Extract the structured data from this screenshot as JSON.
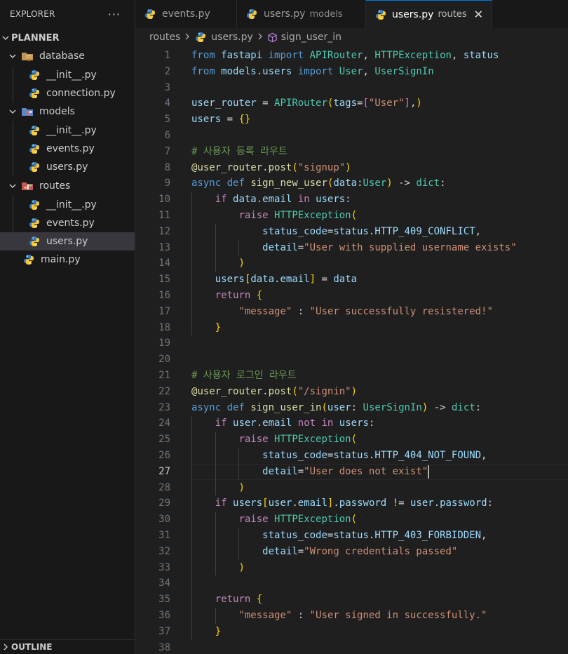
{
  "sidebar": {
    "title": "EXPLORER",
    "more": "···",
    "project": "PLANNER",
    "outline": "OUTLINE",
    "tree": [
      {
        "label": "database",
        "type": "folder"
      },
      {
        "label": "__init__.py",
        "type": "file"
      },
      {
        "label": "connection.py",
        "type": "file"
      },
      {
        "label": "models",
        "type": "folder"
      },
      {
        "label": "__init__.py",
        "type": "file"
      },
      {
        "label": "events.py",
        "type": "file"
      },
      {
        "label": "users.py",
        "type": "file"
      },
      {
        "label": "routes",
        "type": "folder"
      },
      {
        "label": "__init__.py",
        "type": "file"
      },
      {
        "label": "events.py",
        "type": "file"
      },
      {
        "label": "users.py",
        "type": "file",
        "selected": true
      },
      {
        "label": "main.py",
        "type": "file"
      }
    ]
  },
  "tabs": [
    {
      "label": "events.py",
      "desc": ""
    },
    {
      "label": "users.py",
      "desc": "models"
    },
    {
      "label": "users.py",
      "desc": "routes",
      "active": true,
      "close": "✕"
    }
  ],
  "breadcrumb": {
    "folder": "routes",
    "file": "users.py",
    "symbol": "sign_user_in"
  },
  "editor": {
    "current_line": 27,
    "line_numbers": [
      "1",
      "2",
      "3",
      "4",
      "5",
      "6",
      "7",
      "8",
      "9",
      "10",
      "11",
      "12",
      "13",
      "14",
      "15",
      "16",
      "17",
      "18",
      "19",
      "20",
      "21",
      "22",
      "23",
      "24",
      "25",
      "26",
      "27",
      "28",
      "29",
      "30",
      "31",
      "32",
      "33",
      "34",
      "35",
      "36",
      "37",
      "38"
    ],
    "lines": [
      "from fastapi import APIRouter, HTTPException, status",
      "from models.users import User, UserSignIn",
      "",
      "user_router = APIRouter(tags=[\"User\"],)",
      "users = {}",
      "",
      "# 사용자 등록 라우트",
      "@user_router.post(\"signup\")",
      "async def sign_new_user(data:User) -> dict:",
      "    if data.email in users:",
      "        raise HTTPException(",
      "            status_code=status.HTTP_409_CONFLICT,",
      "            detail=\"User with supplied username exists\"",
      "        )",
      "    users[data.email] = data",
      "    return {",
      "        \"message\" : \"User successfully resistered!\"",
      "    }",
      "",
      "",
      "# 사용자 로그인 라우트",
      "@user_router.post(\"/signin\")",
      "async def sign_user_in(user: UserSignIn) -> dict:",
      "    if user.email not in users:",
      "        raise HTTPException(",
      "            status_code=status.HTTP_404_NOT_FOUND,",
      "            detail=\"User does not exist\"",
      "        )",
      "    if users[user.email].password != user.password:",
      "        raise HTTPException(",
      "            status_code=status.HTTP_403_FORBIDDEN,",
      "            detail=\"Wrong credentials passed\"",
      "        )",
      "",
      "    return {",
      "        \"message\" : \"User signed in successfully.\"",
      "    }",
      ""
    ]
  },
  "colors": {
    "accent": "#0078d4",
    "background": "#1f1f1f",
    "sidebar": "#181818",
    "selection": "#37373d"
  },
  "icons": {
    "python_file": "python-logo-icon",
    "folder_database": "database-folder-icon",
    "folder_models": "models-folder-icon",
    "folder_routes": "routes-folder-icon",
    "symbol": "cube-symbol-icon"
  }
}
